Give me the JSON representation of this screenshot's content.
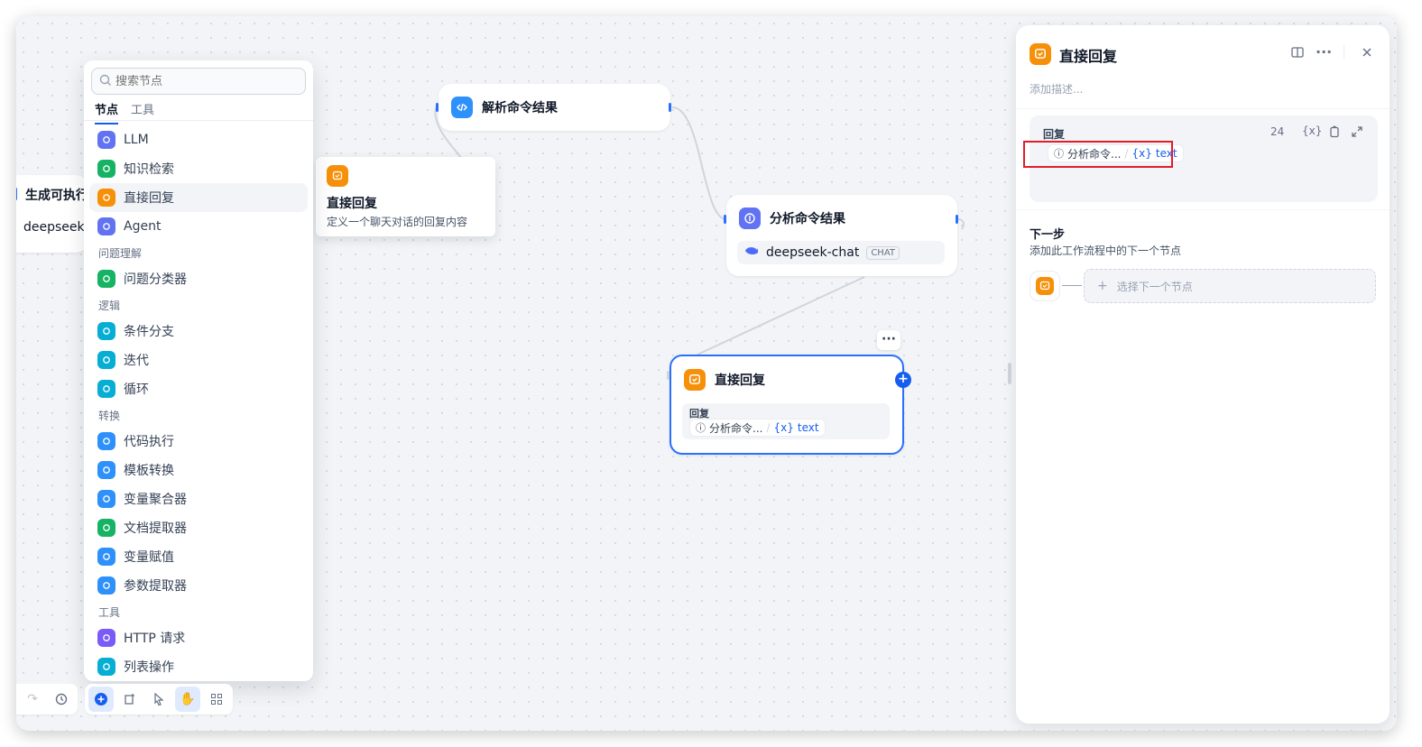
{
  "palette": {
    "search_placeholder": "搜索节点",
    "tabs": [
      "节点",
      "工具"
    ],
    "items": [
      {
        "kind": "item",
        "label": "LLM",
        "icon": "llm-icon",
        "color": "#6172f3"
      },
      {
        "kind": "item",
        "label": "知识检索",
        "icon": "book-icon",
        "color": "#16b364"
      },
      {
        "kind": "item",
        "label": "直接回复",
        "icon": "reply-icon",
        "color": "#f79009",
        "highlight": true
      },
      {
        "kind": "item",
        "label": "Agent",
        "icon": "agent-icon",
        "color": "#6172f3"
      },
      {
        "kind": "group",
        "label": "问题理解"
      },
      {
        "kind": "item",
        "label": "问题分类器",
        "icon": "classifier-icon",
        "color": "#16b364"
      },
      {
        "kind": "group",
        "label": "逻辑"
      },
      {
        "kind": "item",
        "label": "条件分支",
        "icon": "branch-icon",
        "color": "#06aed4"
      },
      {
        "kind": "item",
        "label": "迭代",
        "icon": "iteration-icon",
        "color": "#06aed4"
      },
      {
        "kind": "item",
        "label": "循环",
        "icon": "loop-icon",
        "color": "#06aed4"
      },
      {
        "kind": "group",
        "label": "转换"
      },
      {
        "kind": "item",
        "label": "代码执行",
        "icon": "code-icon",
        "color": "#2e90fa"
      },
      {
        "kind": "item",
        "label": "模板转换",
        "icon": "template-icon",
        "color": "#2e90fa"
      },
      {
        "kind": "item",
        "label": "变量聚合器",
        "icon": "variable-icon",
        "color": "#2e90fa"
      },
      {
        "kind": "item",
        "label": "文档提取器",
        "icon": "document-icon",
        "color": "#16b364"
      },
      {
        "kind": "item",
        "label": "变量赋值",
        "icon": "assign-icon",
        "color": "#2e90fa"
      },
      {
        "kind": "item",
        "label": "参数提取器",
        "icon": "param-icon",
        "color": "#2e90fa"
      },
      {
        "kind": "group",
        "label": "工具"
      },
      {
        "kind": "item",
        "label": "HTTP 请求",
        "icon": "http-icon",
        "color": "#7a5af8"
      },
      {
        "kind": "item",
        "label": "列表操作",
        "icon": "filter-icon",
        "color": "#06aed4"
      }
    ]
  },
  "tooltip": {
    "title": "直接回复",
    "desc": "定义一个聊天对话的回复内容"
  },
  "nodes": {
    "partial": {
      "title": "生成可执行",
      "model": "deepseek-"
    },
    "parse": {
      "title": "解析命令结果"
    },
    "analyze": {
      "title": "分析命令结果",
      "model": "deepseek-chat",
      "badge": "CHAT"
    },
    "reply": {
      "title": "直接回复",
      "field_label": "回复",
      "var_source": "分析命令...",
      "var_name": "text",
      "more": "···"
    }
  },
  "rpanel": {
    "title": "直接回复",
    "desc_placeholder": "添加描述...",
    "reply_label": "回复",
    "char_count": "24",
    "var_source": "分析命令...",
    "var_name": "text",
    "next_title": "下一步",
    "next_desc": "添加此工作流程中的下一个节点",
    "select_next": "选择下一个节点"
  },
  "colors": {
    "accent": "#155eef",
    "highlight_box": "#e11d2a"
  }
}
